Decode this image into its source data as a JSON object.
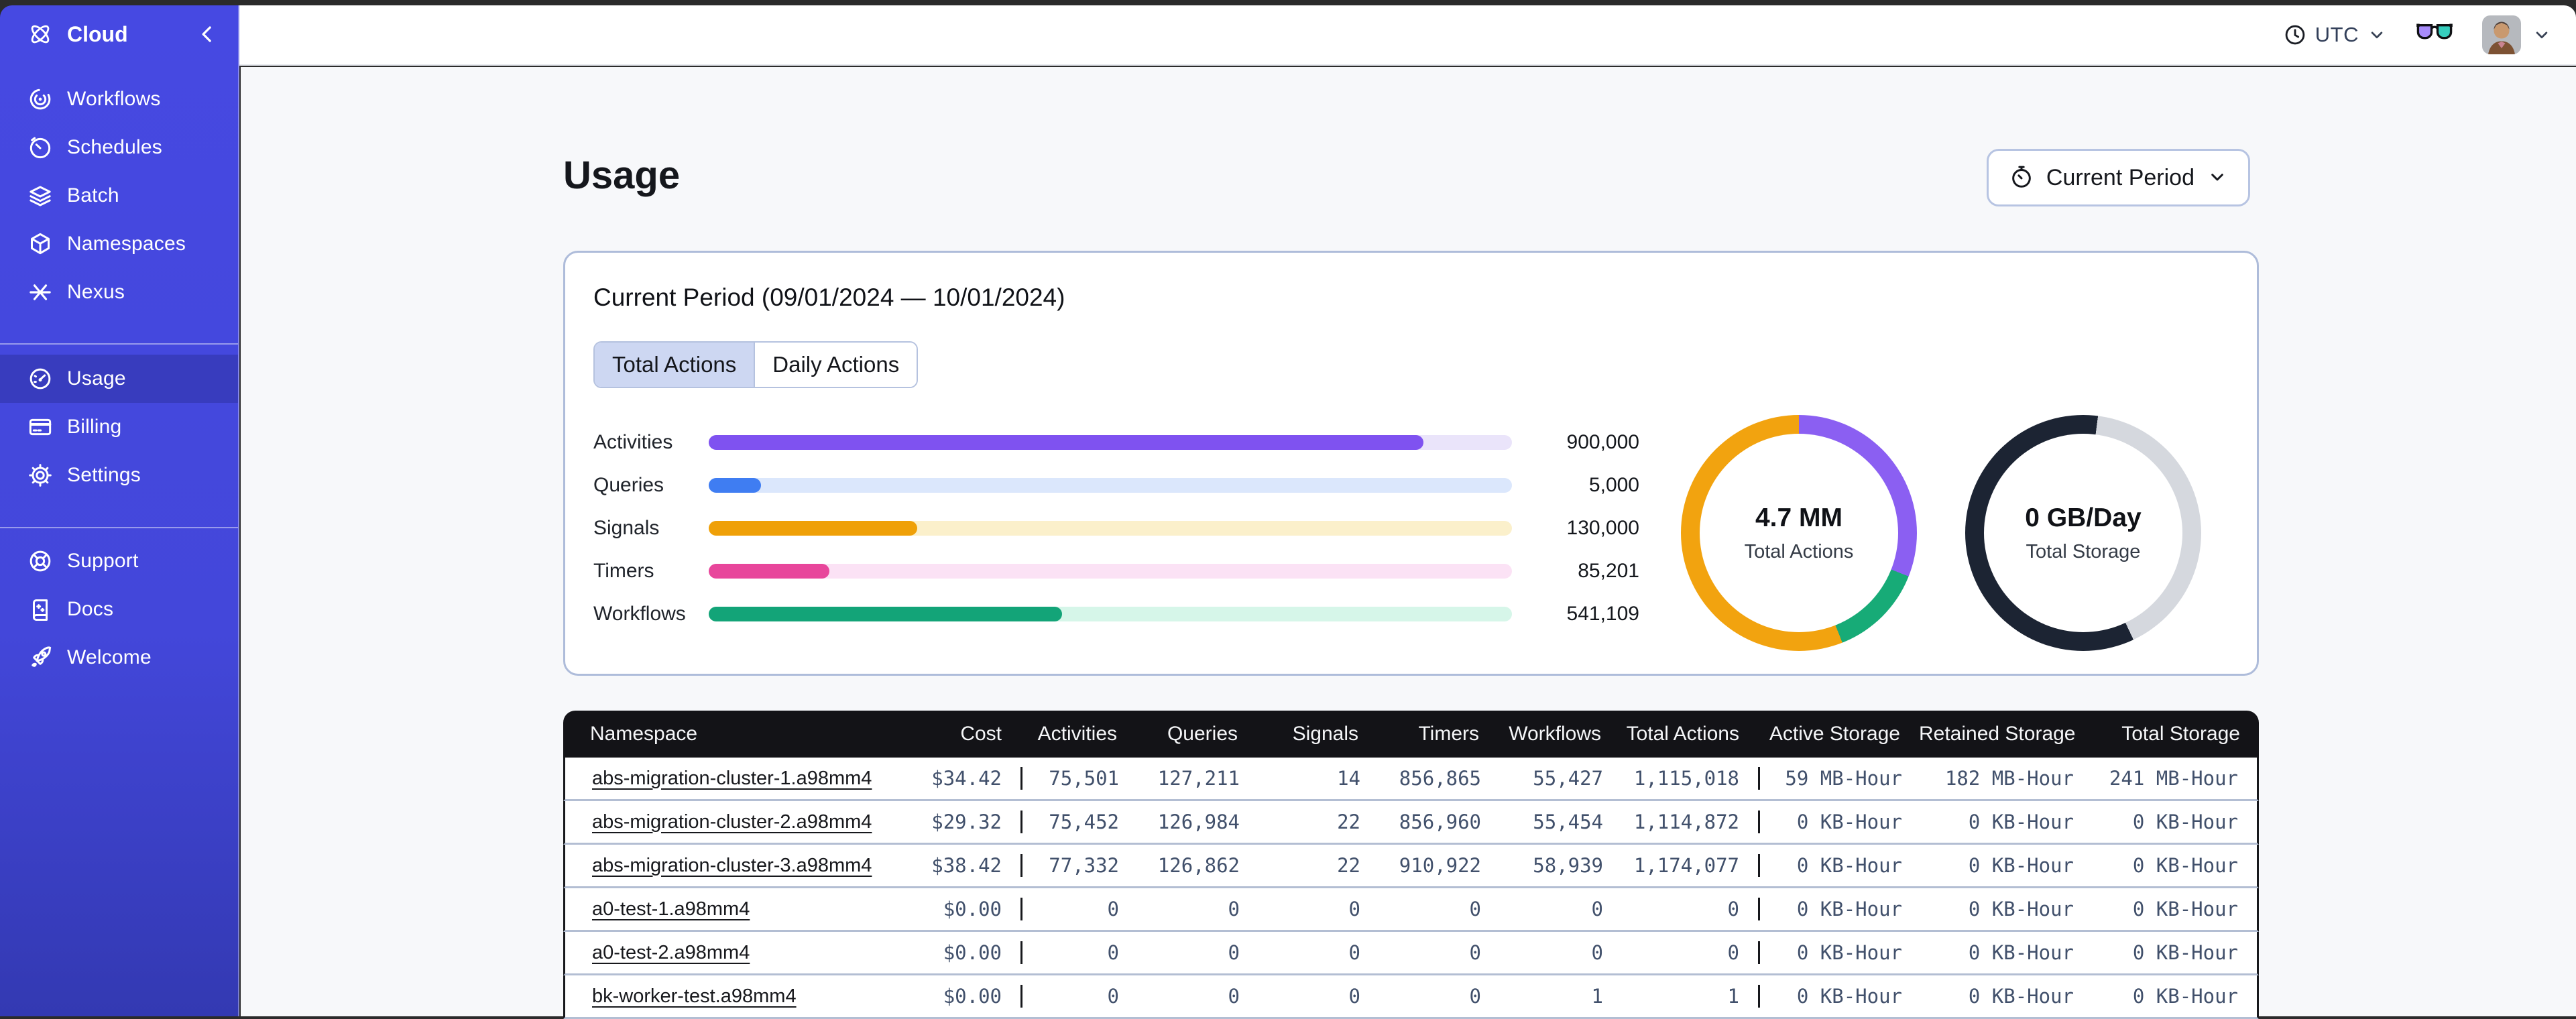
{
  "sidebar": {
    "brand": "Cloud",
    "main": [
      {
        "label": "Workflows",
        "icon": "workflows-icon"
      },
      {
        "label": "Schedules",
        "icon": "schedules-icon"
      },
      {
        "label": "Batch",
        "icon": "batch-icon"
      },
      {
        "label": "Namespaces",
        "icon": "namespaces-icon"
      },
      {
        "label": "Nexus",
        "icon": "nexus-icon"
      }
    ],
    "account": [
      {
        "label": "Usage",
        "icon": "gauge-icon",
        "selected": true
      },
      {
        "label": "Billing",
        "icon": "billing-icon",
        "selected": false
      },
      {
        "label": "Settings",
        "icon": "gear-icon",
        "selected": false
      }
    ],
    "help": [
      {
        "label": "Support",
        "icon": "lifebuoy-icon"
      },
      {
        "label": "Docs",
        "icon": "book-icon"
      },
      {
        "label": "Welcome",
        "icon": "rocket-icon"
      }
    ]
  },
  "topbar": {
    "timezone": "UTC"
  },
  "page": {
    "title": "Usage",
    "period_button": "Current Period"
  },
  "card": {
    "title": "Current Period (09/01/2024 — 10/01/2024)",
    "tabs": [
      {
        "label": "Total Actions",
        "selected": true
      },
      {
        "label": "Daily Actions",
        "selected": false
      }
    ],
    "bars": [
      {
        "label": "Activities",
        "value": "900,000",
        "pct": 89,
        "fill": "#7F52F0",
        "track": "#EAE4FA"
      },
      {
        "label": "Queries",
        "value": "5,000",
        "pct": 6.5,
        "fill": "#3F7DF2",
        "track": "#DBE7FC"
      },
      {
        "label": "Signals",
        "value": "130,000",
        "pct": 26,
        "fill": "#EFA008",
        "track": "#FBF0CB"
      },
      {
        "label": "Timers",
        "value": "85,201",
        "pct": 15,
        "fill": "#E8469B",
        "track": "#FBE2F5"
      },
      {
        "label": "Workflows",
        "value": "541,109",
        "pct": 44,
        "fill": "#13A478",
        "track": "#D6F6E9"
      }
    ],
    "donuts": [
      {
        "value": "4.7 MM",
        "label": "Total Actions",
        "segments": [
          {
            "color": "#8B5FF2",
            "from": 0,
            "to": 31
          },
          {
            "color": "#17AB77",
            "from": 31,
            "to": 44
          },
          {
            "color": "#F2A30F",
            "from": 44,
            "to": 100
          }
        ]
      },
      {
        "value": "0 GB/Day",
        "label": "Total Storage",
        "segments": [
          {
            "color": "#1C2433",
            "from": 0,
            "to": 2
          },
          {
            "color": "#D5D8DE",
            "from": 2,
            "to": 43
          },
          {
            "color": "#1C2433",
            "from": 43,
            "to": 100
          }
        ]
      }
    ]
  },
  "table": {
    "columns": [
      "Namespace",
      "Cost",
      "Activities",
      "Queries",
      "Signals",
      "Timers",
      "Workflows",
      "Total Actions",
      "Active Storage",
      "Retained Storage",
      "Total Storage"
    ],
    "rows": [
      {
        "cells": [
          "abs-migration-cluster-1.a98mm4",
          "$34.42",
          "75,501",
          "127,211",
          "14",
          "856,865",
          "55,427",
          "1,115,018",
          "59 MB-Hour",
          "182 MB-Hour",
          "241 MB-Hour"
        ]
      },
      {
        "cells": [
          "abs-migration-cluster-2.a98mm4",
          "$29.32",
          "75,452",
          "126,984",
          "22",
          "856,960",
          "55,454",
          "1,114,872",
          "0 KB-Hour",
          "0 KB-Hour",
          "0 KB-Hour"
        ]
      },
      {
        "cells": [
          "abs-migration-cluster-3.a98mm4",
          "$38.42",
          "77,332",
          "126,862",
          "22",
          "910,922",
          "58,939",
          "1,174,077",
          "0 KB-Hour",
          "0 KB-Hour",
          "0 KB-Hour"
        ]
      },
      {
        "cells": [
          "a0-test-1.a98mm4",
          "$0.00",
          "0",
          "0",
          "0",
          "0",
          "0",
          "0",
          "0 KB-Hour",
          "0 KB-Hour",
          "0 KB-Hour"
        ]
      },
      {
        "cells": [
          "a0-test-2.a98mm4",
          "$0.00",
          "0",
          "0",
          "0",
          "0",
          "0",
          "0",
          "0 KB-Hour",
          "0 KB-Hour",
          "0 KB-Hour"
        ]
      },
      {
        "cells": [
          "bk-worker-test.a98mm4",
          "$0.00",
          "0",
          "0",
          "0",
          "0",
          "1",
          "1",
          "0 KB-Hour",
          "0 KB-Hour",
          "0 KB-Hour"
        ]
      }
    ]
  }
}
